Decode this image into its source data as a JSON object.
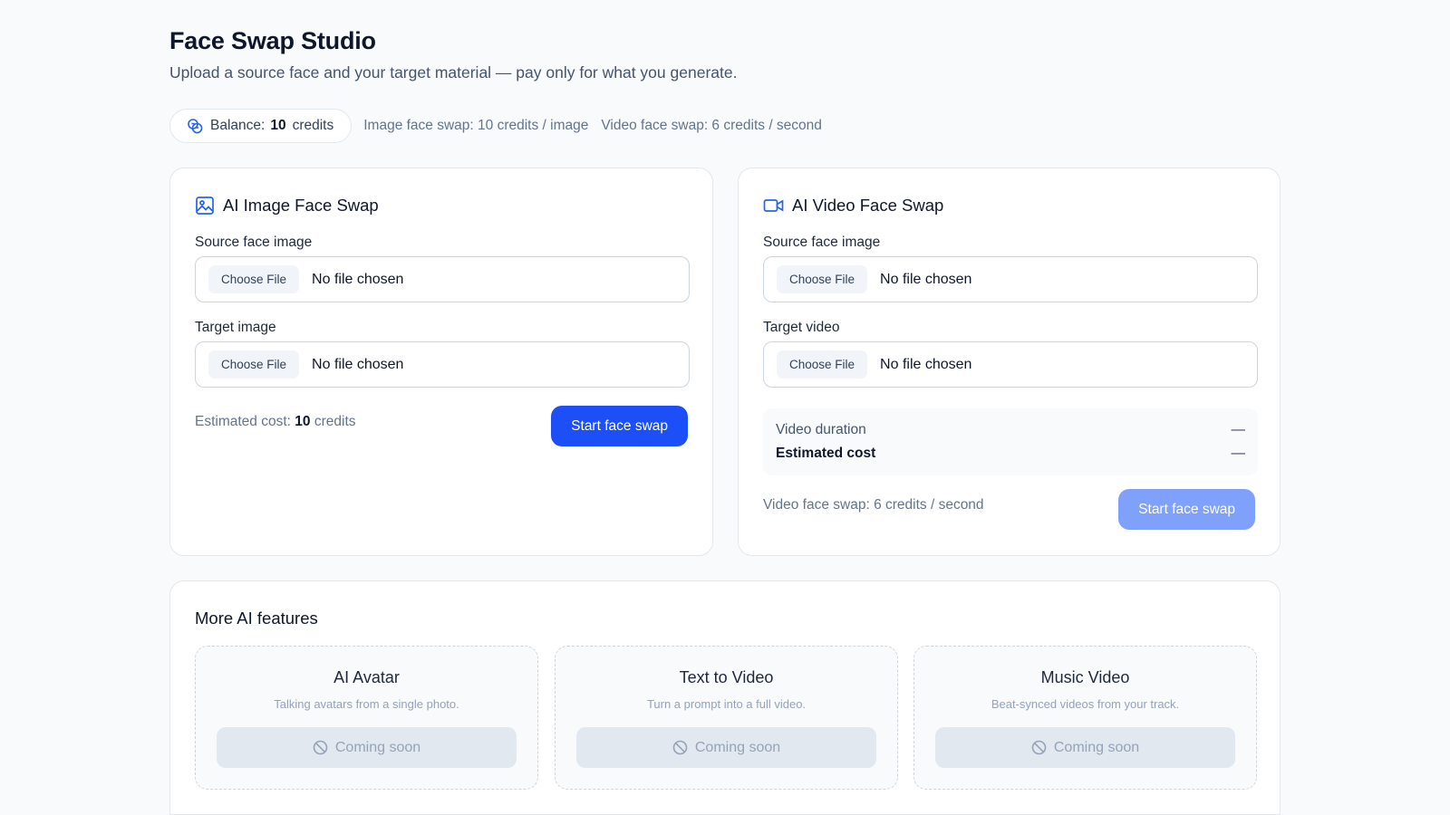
{
  "header": {
    "title": "Face Swap Studio",
    "subtitle": "Upload a source face and your target material — pay only for what you generate."
  },
  "balance": {
    "label": "Balance:",
    "amount": "10",
    "unit": "credits",
    "icon": "coins-icon"
  },
  "rates": {
    "image": "Image face swap: 10 credits / image",
    "video": "Video face swap: 6 credits / second"
  },
  "image_card": {
    "title": "AI Image Face Swap",
    "icon": "image-icon",
    "source_label": "Source face image",
    "target_label": "Target image",
    "choose_label": "Choose File",
    "file_status": "No file chosen",
    "cost_prefix": "Estimated cost:",
    "cost_value": "10",
    "cost_unit": "credits",
    "button": "Start face swap"
  },
  "video_card": {
    "title": "AI Video Face Swap",
    "icon": "video-icon",
    "source_label": "Source face image",
    "target_label": "Target video",
    "choose_label": "Choose File",
    "file_status": "No file chosen",
    "duration_label": "Video duration",
    "duration_value": "—",
    "cost_label": "Estimated cost",
    "cost_value": "—",
    "rate_note": "Video face swap: 6 credits / second",
    "button": "Start face swap",
    "button_disabled": true
  },
  "more": {
    "title": "More AI features",
    "features": [
      {
        "title": "AI Avatar",
        "desc": "Talking avatars from a single photo.",
        "button": "Coming soon"
      },
      {
        "title": "Text to Video",
        "desc": "Turn a prompt into a full video.",
        "button": "Coming soon"
      },
      {
        "title": "Music Video",
        "desc": "Beat-synced videos from your track.",
        "button": "Coming soon"
      }
    ]
  },
  "colors": {
    "primary": "#1c4ff5",
    "primary_disabled": "#7fa1fb",
    "background": "#f8fafc"
  }
}
